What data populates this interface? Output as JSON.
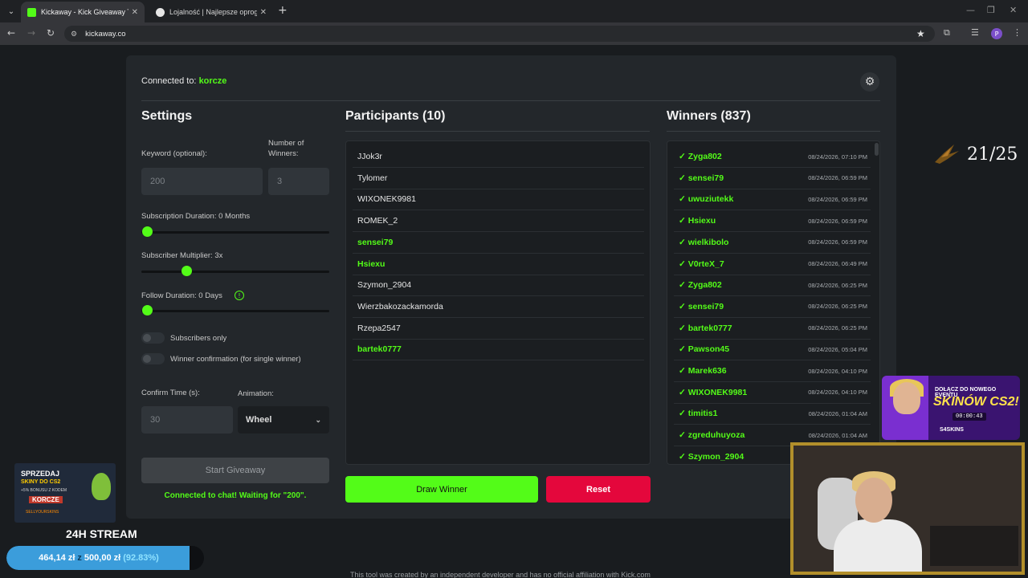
{
  "browser": {
    "tabs": [
      {
        "title": "Kickaway - Kick Giveaway Tool",
        "active": true
      },
      {
        "title": "Lojalność | Najlepsze oprogram",
        "active": false
      }
    ],
    "url": "kickaway.co"
  },
  "header": {
    "connected_label": "Connected to:",
    "channel": "korcze"
  },
  "settings": {
    "title": "Settings",
    "keyword_label": "Keyword (optional):",
    "keyword_placeholder": "200",
    "winners_label": "Number of Winners:",
    "winners_placeholder": "3",
    "sub_duration_label": "Subscription Duration: 0 Months",
    "sub_duration_value": 0,
    "sub_multiplier_label": "Subscriber Multiplier: 3x",
    "sub_multiplier_value": 3,
    "follow_duration_label": "Follow Duration:  0  Days",
    "follow_duration_value": 0,
    "subscribers_only_label": "Subscribers only",
    "subscribers_only": false,
    "winner_confirmation_label": "Winner confirmation (for single winner)",
    "winner_confirmation": false,
    "confirm_time_label": "Confirm Time (s):",
    "confirm_time_placeholder": "30",
    "animation_label": "Animation:",
    "animation_value": "Wheel",
    "start_button": "Start Giveaway",
    "status": "Connected to chat! Waiting for \"200\"."
  },
  "participants": {
    "title": "Participants (10)",
    "items": [
      {
        "name": "JJok3r",
        "highlight": false
      },
      {
        "name": "Tylomer",
        "highlight": false
      },
      {
        "name": "WIXONEK9981",
        "highlight": false
      },
      {
        "name": "ROMEK_2",
        "highlight": false
      },
      {
        "name": "sensei79",
        "highlight": true
      },
      {
        "name": "Hsiexu",
        "highlight": true
      },
      {
        "name": "Szymon_2904",
        "highlight": false
      },
      {
        "name": "Wierzbakozackamorda",
        "highlight": false
      },
      {
        "name": "Rzepa2547",
        "highlight": false
      },
      {
        "name": "bartek0777",
        "highlight": true
      }
    ]
  },
  "winners": {
    "title": "Winners (837)",
    "items": [
      {
        "name": "✓ Zyga802",
        "date": "08/24/2026, 07:10 PM"
      },
      {
        "name": "✓ sensei79",
        "date": "08/24/2026, 06:59 PM"
      },
      {
        "name": "✓ uwuziutekk",
        "date": "08/24/2026, 06:59 PM"
      },
      {
        "name": "✓ Hsiexu",
        "date": "08/24/2026, 06:59 PM"
      },
      {
        "name": "✓ wielkibolo",
        "date": "08/24/2026, 06:59 PM"
      },
      {
        "name": "✓ V0rteX_7",
        "date": "08/24/2026, 06:49 PM"
      },
      {
        "name": "✓ Zyga802",
        "date": "08/24/2026, 06:25 PM"
      },
      {
        "name": "✓ sensei79",
        "date": "08/24/2026, 06:25 PM"
      },
      {
        "name": "✓ bartek0777",
        "date": "08/24/2026, 06:25 PM"
      },
      {
        "name": "✓ Pawson45",
        "date": "08/24/2026, 05:04 PM"
      },
      {
        "name": "✓ Marek636",
        "date": "08/24/2026, 04:10 PM"
      },
      {
        "name": "✓ WIXONEK9981",
        "date": "08/24/2026, 04:10 PM"
      },
      {
        "name": "✓ timitis1",
        "date": "08/24/2026, 01:04 AM"
      },
      {
        "name": "✓ zgreduhuyoza",
        "date": "08/24/2026, 01:04 AM"
      },
      {
        "name": "✓ Szymon_2904",
        "date": ""
      }
    ]
  },
  "actions": {
    "draw_winner": "Draw Winner",
    "reset": "Reset"
  },
  "footer": "This tool was created by an independent developer and has no official affiliation with Kick.com",
  "overlay": {
    "goal_count": "21/25",
    "promo_right": {
      "line1": "DOŁĄCZ DO NOWEGO EVENTU",
      "line2": "SKINÓW CS2!",
      "timer": "00:00:43",
      "brand": "S4SKINS"
    },
    "promo_left": {
      "line1": "SPRZEDAJ",
      "line2": "SKINY DO CS2",
      "line3": "+5% BONUSU Z KODEM",
      "code": "KORCZE",
      "brand": "SELLYOURSKINS"
    },
    "stream_title": "24H STREAM",
    "donation": {
      "current": "464,14 zł",
      "separator": "z",
      "target": "500,00 zł",
      "percent_label": "(92.83%)",
      "percent": 92.83
    }
  },
  "colors": {
    "accent": "#53fc18",
    "danger": "#e4073c",
    "card": "#23272b",
    "background": "#191c1f"
  }
}
